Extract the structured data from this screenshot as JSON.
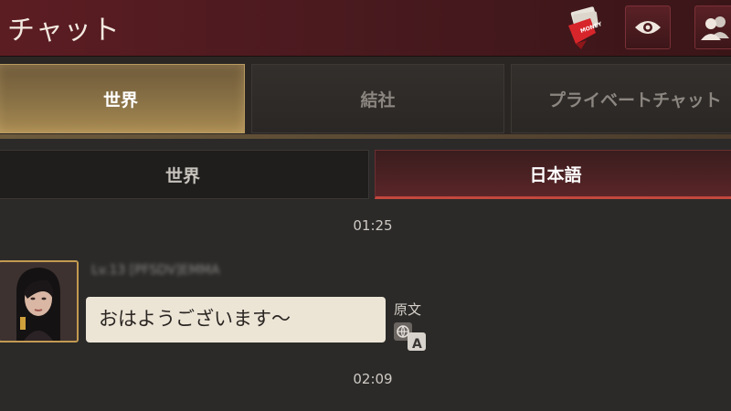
{
  "header": {
    "title": "チャット",
    "money_badge": "MONEY"
  },
  "main_tabs": [
    {
      "label": "世界",
      "active": true
    },
    {
      "label": "結社",
      "active": false
    },
    {
      "label": "プライベートチャット",
      "active": false
    }
  ],
  "sub_tabs": [
    {
      "label": "世界",
      "active": false
    },
    {
      "label": "日本語",
      "active": true
    }
  ],
  "chat": {
    "timestamp_1": "01:25",
    "message": {
      "sender": "Lv.13 [PFSDV]EMMA",
      "text": "おはようございます～",
      "original_label": "原文"
    },
    "timestamp_2": "02:09"
  },
  "colors": {
    "header_bg": "#4a1a1f",
    "active_tab_gold": "#a88b52",
    "subtab_accent": "#c2473e",
    "bubble_bg": "#ece5d6"
  }
}
